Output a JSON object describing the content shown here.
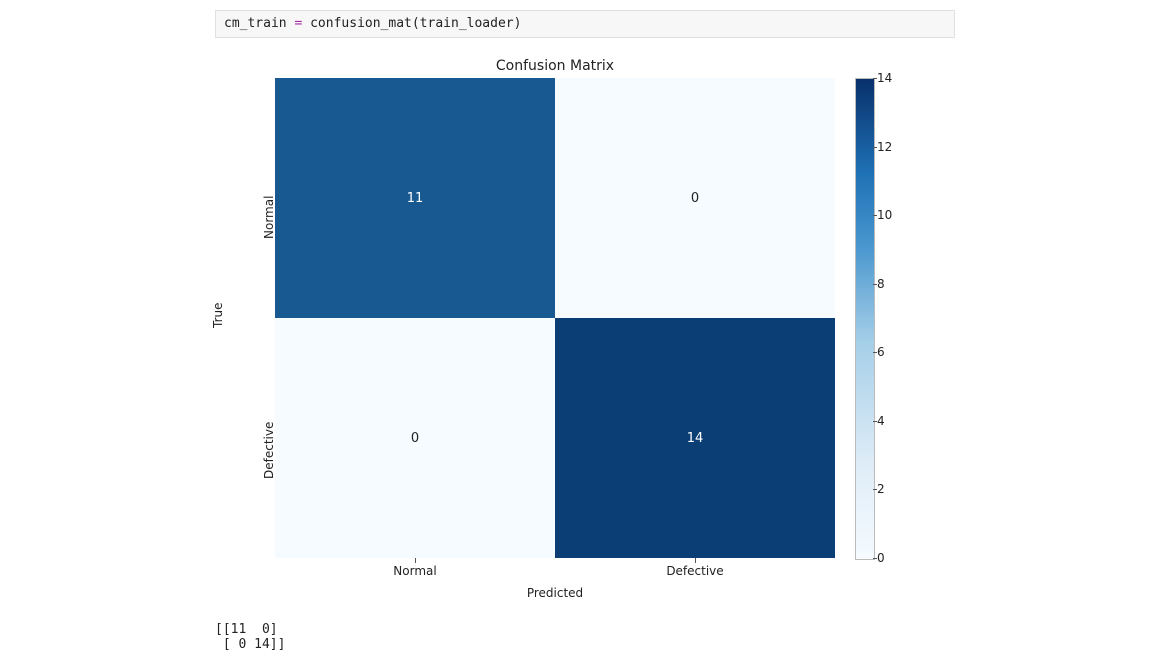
{
  "code": {
    "var": "cm_train",
    "op": "=",
    "call": "confusion_mat(train_loader)"
  },
  "chart_data": {
    "type": "heatmap",
    "title": "Confusion Matrix",
    "xlabel": "Predicted",
    "ylabel": "True",
    "categories_x": [
      "Normal",
      "Defective"
    ],
    "categories_y": [
      "Normal",
      "Defective"
    ],
    "values": [
      [
        11,
        0
      ],
      [
        0,
        14
      ]
    ],
    "cbar_ticks": [
      0,
      2,
      4,
      6,
      8,
      10,
      12,
      14
    ],
    "vmin": 0,
    "vmax": 14,
    "colors": {
      "low": "#f5fbff",
      "mid": "#2a7db9",
      "high": "#0a3e75"
    }
  },
  "output_text": "[[11  0]\n [ 0 14]]"
}
